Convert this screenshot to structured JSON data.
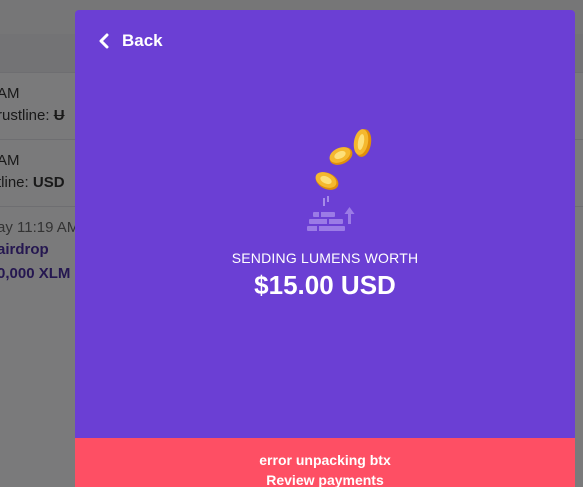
{
  "background": {
    "rows": [
      {
        "time": "AM",
        "detail_prefix": "rustline: ",
        "detail_value": "U"
      },
      {
        "time": "AM",
        "detail_prefix": "tline: ",
        "detail_value": "USD"
      },
      {
        "time": "ay 11:19 AM",
        "title": "airdrop",
        "amount": "0,000 XLM"
      }
    ]
  },
  "modal": {
    "back_label": "Back",
    "caption": "SENDING LUMENS WORTH",
    "amount": "$15.00 USD",
    "error_message": "error unpacking btx",
    "error_link": "Review payments"
  },
  "colors": {
    "modal_bg": "#6b3fd4",
    "error_bg": "#fe4f64",
    "coin": "#f5b82e",
    "purple_text": "#4a2fa0"
  },
  "icons": {
    "back": "chevron-left-icon",
    "illustration": "coins-sending-icon"
  }
}
